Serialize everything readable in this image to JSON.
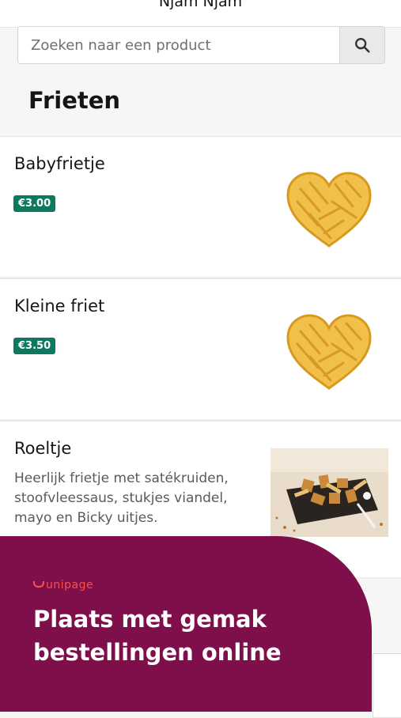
{
  "header": {
    "shop_name": "Njam Njam"
  },
  "search": {
    "placeholder": "Zoeken naar een product",
    "icon": "search-icon"
  },
  "category": {
    "title": "Frieten"
  },
  "products": [
    {
      "name": "Babyfrietje",
      "price": "€3.00",
      "image": "heart-fries"
    },
    {
      "name": "Kleine friet",
      "price": "€3.50",
      "image": "heart-fries"
    },
    {
      "name": "Roeltje",
      "description": "Heerlijk frietje met satékruiden, stoofvleessaus, stukjes viandel, mayo en Bicky uitjes.",
      "image": "fries-tray-photo"
    }
  ],
  "promo": {
    "brand": "unipage",
    "text": "Plaats met gemak bestellingen online",
    "background": "#7f0f4a",
    "brand_color": "#ff4f4a"
  },
  "colors": {
    "price_badge": "#0d7a5f",
    "page_bg": "#f5f6f5"
  }
}
